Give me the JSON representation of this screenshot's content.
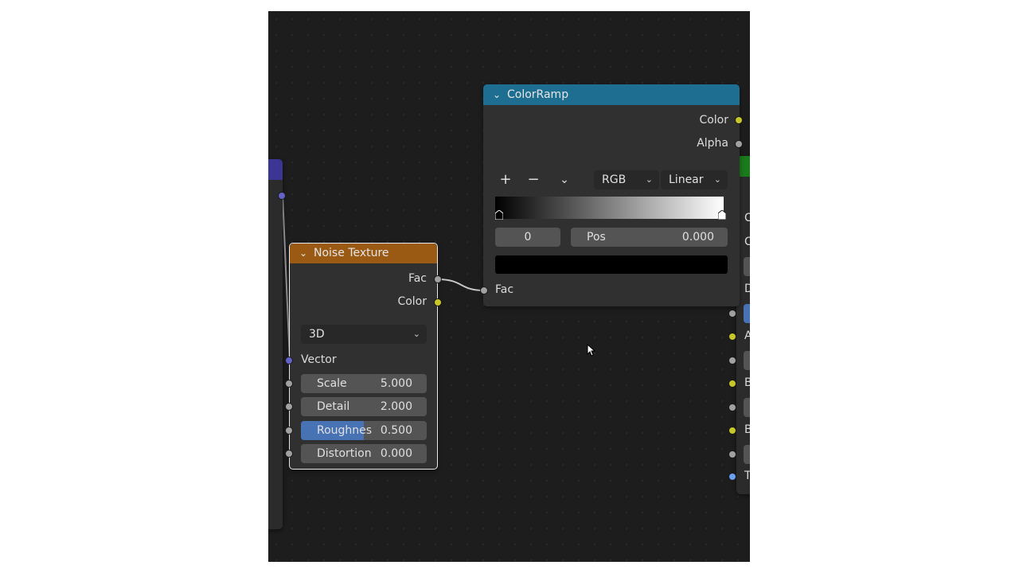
{
  "colorramp": {
    "title": "ColorRamp",
    "out_color": "Color",
    "out_alpha": "Alpha",
    "add_icon": "+",
    "remove_icon": "−",
    "menu_icon": "⌄",
    "color_mode": "RGB",
    "interpolation": "Linear",
    "stop_index": "0",
    "pos_label": "Pos",
    "pos_value": "0.000",
    "input_fac": "Fac"
  },
  "noise": {
    "title": "Noise Texture",
    "out_fac": "Fac",
    "out_color": "Color",
    "dimensions": "3D",
    "vector_label": "Vector",
    "fields": [
      {
        "label": "Scale",
        "value": "5.000"
      },
      {
        "label": "Detail",
        "value": "2.000"
      },
      {
        "label": "Roughnes",
        "value": "0.500",
        "fill": 0.5
      },
      {
        "label": "Distortion",
        "value": "0.000"
      }
    ]
  },
  "right_node_letters": [
    "C",
    "C",
    "D",
    "A",
    "B",
    "B",
    "T"
  ],
  "colors": {
    "colorramp_header": "#1e6e92",
    "noise_header": "#9a5a14",
    "left_header": "#3b3594",
    "right_header": "#1b7a1b",
    "accent_blue": "#4772b3"
  }
}
